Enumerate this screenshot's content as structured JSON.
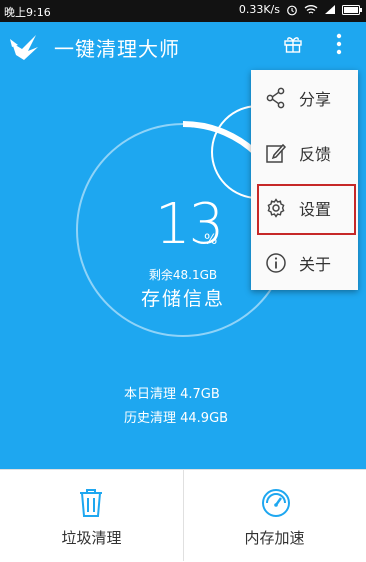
{
  "status_bar": {
    "time": "晚上9:16",
    "network_speed": "0.33K/s",
    "icons": [
      "alarm-icon",
      "wifi-icon",
      "signal-icon",
      "battery-icon"
    ]
  },
  "header": {
    "title": "一键清理大师",
    "icons": [
      "app-logo-icon",
      "gift-icon",
      "more-icon"
    ]
  },
  "storage": {
    "percent": "13",
    "percent_sign": "%",
    "remaining": "剩余48.1GB",
    "label": "存储信息",
    "fill_fraction": 0.13
  },
  "stats": {
    "today": "本日清理 4.7GB",
    "history": "历史清理 44.9GB"
  },
  "menu": {
    "items": [
      {
        "label": "分享",
        "icon": "share-icon"
      },
      {
        "label": "反馈",
        "icon": "feedback-icon"
      },
      {
        "label": "设置",
        "icon": "settings-icon"
      },
      {
        "label": "关于",
        "icon": "info-icon"
      }
    ],
    "highlighted": "设置"
  },
  "bottom_tabs": [
    {
      "label": "垃圾清理",
      "icon": "trash-icon"
    },
    {
      "label": "内存加速",
      "icon": "speedometer-icon"
    }
  ],
  "colors": {
    "primary": "#1ea7f0",
    "highlight_border": "#c62828"
  }
}
